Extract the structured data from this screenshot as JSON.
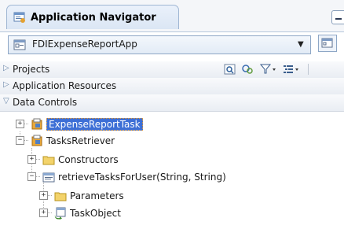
{
  "panel": {
    "title": "Application Navigator"
  },
  "selector": {
    "value": "FDIExpenseReportApp"
  },
  "accordion": [
    {
      "label": "Projects",
      "expanded": false
    },
    {
      "label": "Application Resources",
      "expanded": false
    },
    {
      "label": "Data Controls",
      "expanded": true
    }
  ],
  "tree": {
    "items": [
      {
        "label": "ExpenseReportTask",
        "selected": true,
        "expander": "+"
      },
      {
        "label": "TasksRetriever",
        "selected": false,
        "expander": "−"
      },
      {
        "label": "Constructors",
        "selected": false,
        "expander": "+"
      },
      {
        "label": "retrieveTasksForUser(String, String)",
        "selected": false,
        "expander": "−"
      },
      {
        "label": "Parameters",
        "selected": false,
        "expander": "+"
      },
      {
        "label": "TaskObject",
        "selected": false,
        "expander": "+"
      }
    ]
  },
  "colors": {
    "selection": "#3d6fd6",
    "accent_border": "#9fb6d3"
  }
}
